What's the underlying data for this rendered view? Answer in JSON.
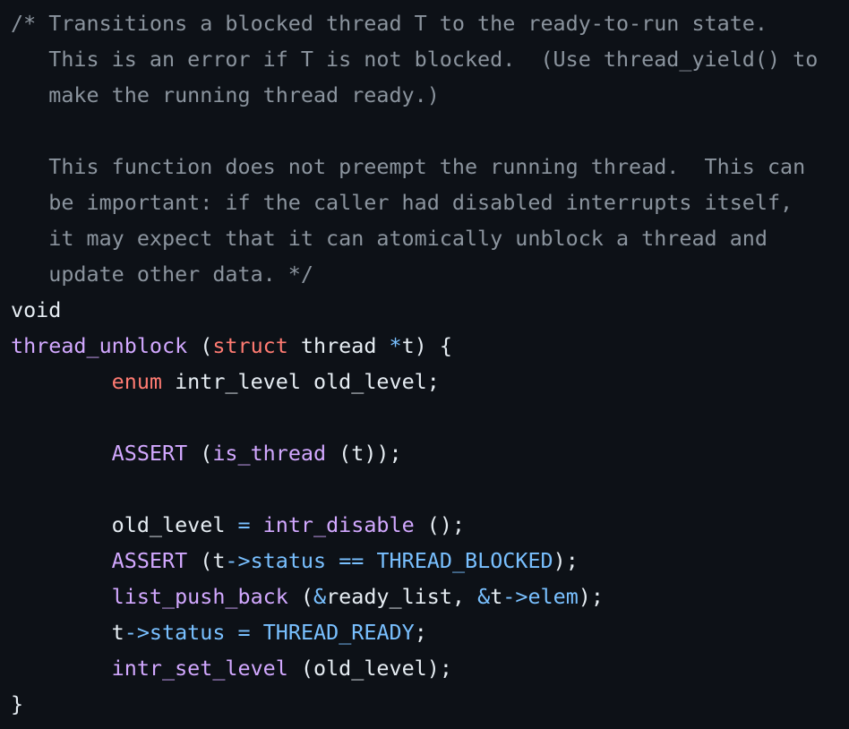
{
  "colors": {
    "background": "#0d1117",
    "text": "#e6edf3",
    "comment": "#8b949e",
    "keyword": "#ff7b72",
    "function": "#d2a8ff",
    "constant": "#79c0ff"
  },
  "lines": [
    [
      {
        "t": "/* Transitions a blocked thread T to the ready-to-run state.",
        "k": "c"
      }
    ],
    [
      {
        "t": "   This is an error if T is not blocked.  (Use thread_yield() to",
        "k": "c"
      }
    ],
    [
      {
        "t": "   make the running thread ready.)",
        "k": "c"
      }
    ],
    [
      {
        "t": "",
        "k": "c"
      }
    ],
    [
      {
        "t": "   This function does not preempt the running thread.  This can",
        "k": "c"
      }
    ],
    [
      {
        "t": "   be important: if the caller had disabled interrupts itself,",
        "k": "c"
      }
    ],
    [
      {
        "t": "   it may expect that it can atomically unblock a thread and",
        "k": "c"
      }
    ],
    [
      {
        "t": "   update other data. */",
        "k": "c"
      }
    ],
    [
      {
        "t": "void",
        "k": "tx"
      }
    ],
    [
      {
        "t": "thread_unblock",
        "k": "fn"
      },
      {
        "t": " (",
        "k": "tx"
      },
      {
        "t": "struct",
        "k": "kw"
      },
      {
        "t": " thread ",
        "k": "tx"
      },
      {
        "t": "*",
        "k": "op"
      },
      {
        "t": "t) {",
        "k": "tx"
      }
    ],
    [
      {
        "t": "        ",
        "k": "tx"
      },
      {
        "t": "enum",
        "k": "kw"
      },
      {
        "t": " intr_level old_level;",
        "k": "tx"
      }
    ],
    [
      {
        "t": "",
        "k": "tx"
      }
    ],
    [
      {
        "t": "        ",
        "k": "tx"
      },
      {
        "t": "ASSERT",
        "k": "fn"
      },
      {
        "t": " (",
        "k": "tx"
      },
      {
        "t": "is_thread",
        "k": "fn"
      },
      {
        "t": " (t));",
        "k": "tx"
      }
    ],
    [
      {
        "t": "",
        "k": "tx"
      }
    ],
    [
      {
        "t": "        old_level ",
        "k": "tx"
      },
      {
        "t": "=",
        "k": "op"
      },
      {
        "t": " ",
        "k": "tx"
      },
      {
        "t": "intr_disable",
        "k": "fn"
      },
      {
        "t": " ();",
        "k": "tx"
      }
    ],
    [
      {
        "t": "        ",
        "k": "tx"
      },
      {
        "t": "ASSERT",
        "k": "fn"
      },
      {
        "t": " (t",
        "k": "tx"
      },
      {
        "t": "->",
        "k": "op"
      },
      {
        "t": "status",
        "k": "cn"
      },
      {
        "t": " ",
        "k": "tx"
      },
      {
        "t": "==",
        "k": "op"
      },
      {
        "t": " ",
        "k": "tx"
      },
      {
        "t": "THREAD_BLOCKED",
        "k": "cn"
      },
      {
        "t": ");",
        "k": "tx"
      }
    ],
    [
      {
        "t": "        ",
        "k": "tx"
      },
      {
        "t": "list_push_back",
        "k": "fn"
      },
      {
        "t": " (",
        "k": "tx"
      },
      {
        "t": "&",
        "k": "op"
      },
      {
        "t": "ready_list, ",
        "k": "tx"
      },
      {
        "t": "&",
        "k": "op"
      },
      {
        "t": "t",
        "k": "tx"
      },
      {
        "t": "->",
        "k": "op"
      },
      {
        "t": "elem",
        "k": "cn"
      },
      {
        "t": ");",
        "k": "tx"
      }
    ],
    [
      {
        "t": "        t",
        "k": "tx"
      },
      {
        "t": "->",
        "k": "op"
      },
      {
        "t": "status",
        "k": "cn"
      },
      {
        "t": " ",
        "k": "tx"
      },
      {
        "t": "=",
        "k": "op"
      },
      {
        "t": " ",
        "k": "tx"
      },
      {
        "t": "THREAD_READY",
        "k": "cn"
      },
      {
        "t": ";",
        "k": "tx"
      }
    ],
    [
      {
        "t": "        ",
        "k": "tx"
      },
      {
        "t": "intr_set_level",
        "k": "fn"
      },
      {
        "t": " (old_level);",
        "k": "tx"
      }
    ],
    [
      {
        "t": "}",
        "k": "tx"
      }
    ]
  ]
}
